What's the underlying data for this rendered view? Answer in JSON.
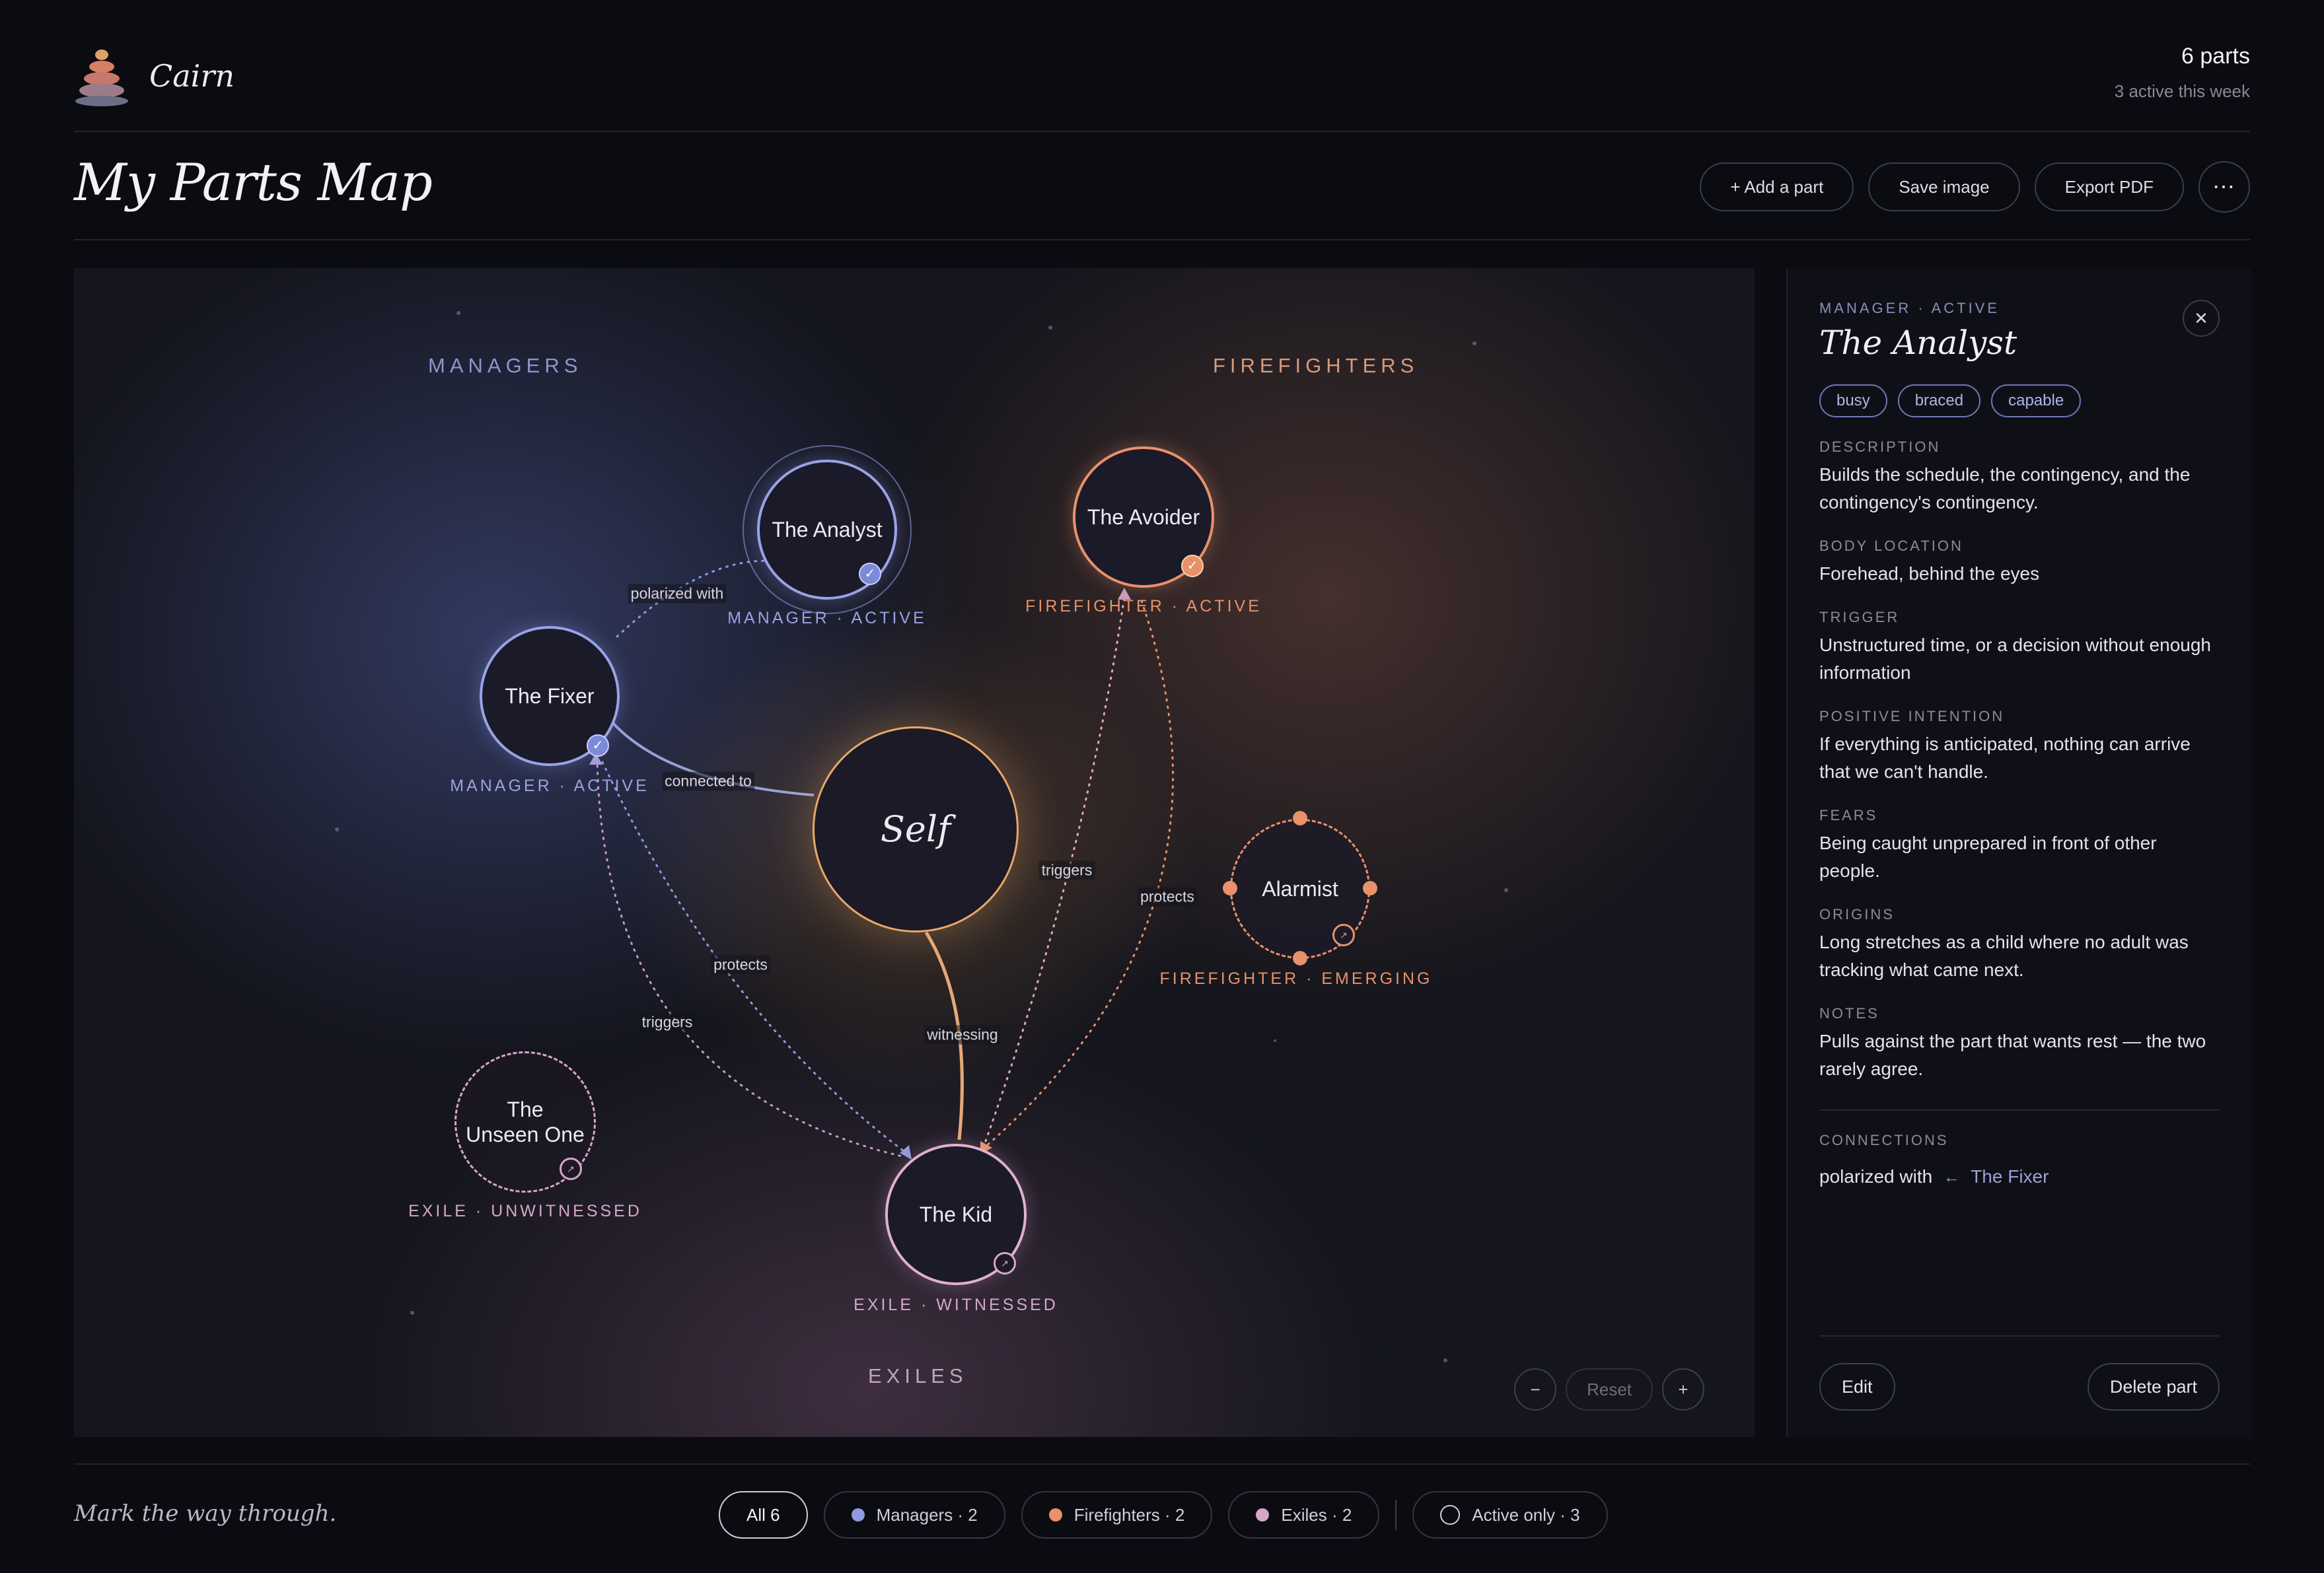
{
  "brand": {
    "name": "Cairn"
  },
  "summary": {
    "count": "6 parts",
    "active": "3 active this week"
  },
  "page": {
    "title": "My Parts Map"
  },
  "toolbar": {
    "add": "+ Add a part",
    "save": "Save image",
    "export": "Export PDF",
    "more": "⋯"
  },
  "map": {
    "zones": {
      "managers": "MANAGERS",
      "firefighters": "FIREFIGHTERS",
      "exiles": "EXILES"
    },
    "self": "Self",
    "nodes": {
      "analyst": {
        "name": "The Analyst",
        "status": "MANAGER · ACTIVE"
      },
      "fixer": {
        "name": "The Fixer",
        "status": "MANAGER · ACTIVE"
      },
      "avoider": {
        "name": "The Avoider",
        "status": "FIREFIGHTER · ACTIVE"
      },
      "alarmist": {
        "name": "Alarmist",
        "status": "FIREFIGHTER · EMERGING"
      },
      "unseen": {
        "name_line1": "The",
        "name_line2": "Unseen One",
        "status": "EXILE · UNWITNESSED"
      },
      "kid": {
        "name": "The Kid",
        "status": "EXILE · WITNESSED"
      }
    },
    "edges": {
      "polarized": "polarized with",
      "connected": "connected to",
      "triggers_avoider": "triggers",
      "protects_avoider": "protects",
      "protects_fixer": "protects",
      "triggers_fixer": "triggers",
      "witnessing": "witnessing"
    },
    "zoom": {
      "out": "−",
      "reset": "Reset",
      "in": "+"
    },
    "colors": {
      "manager": "#8f9ae0",
      "firefighter": "#e8916a",
      "exile": "#d7a6c8",
      "self": "#e9a86a"
    }
  },
  "detail": {
    "kicker": "MANAGER · ACTIVE",
    "title": "The Analyst",
    "close": "✕",
    "tags": [
      "busy",
      "braced",
      "capable"
    ],
    "fields": {
      "description": {
        "label": "DESCRIPTION",
        "value": "Builds the schedule, the contingency, and the contingency's contingency."
      },
      "body": {
        "label": "BODY LOCATION",
        "value": "Forehead, behind the eyes"
      },
      "trigger": {
        "label": "TRIGGER",
        "value": "Unstructured time, or a decision without enough information"
      },
      "intention": {
        "label": "POSITIVE INTENTION",
        "value": "If everything is anticipated, nothing can arrive that we can't handle."
      },
      "fears": {
        "label": "FEARS",
        "value": "Being caught unprepared in front of other people."
      },
      "origins": {
        "label": "ORIGINS",
        "value": "Long stretches as a child where no adult was tracking what came next."
      },
      "notes": {
        "label": "NOTES",
        "value": "Pulls against the part that wants rest — the two rarely agree."
      }
    },
    "connections": {
      "label": "CONNECTIONS",
      "relation": "polarized with",
      "arrow": "←",
      "target": "The Fixer"
    },
    "edit": "Edit",
    "delete": "Delete part"
  },
  "footer": {
    "tagline": "Mark the way through.",
    "filters": {
      "all": "All 6",
      "managers": "Managers · 2",
      "firefighters": "Firefighters · 2",
      "exiles": "Exiles · 2",
      "active": "Active only · 3"
    }
  }
}
